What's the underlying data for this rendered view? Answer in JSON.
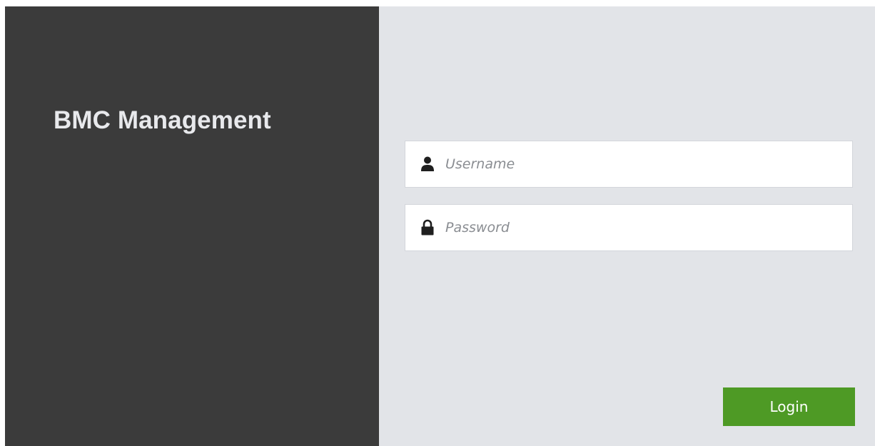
{
  "branding": {
    "title": "BMC Management"
  },
  "login_form": {
    "username": {
      "placeholder": "Username",
      "value": "",
      "icon": "user-icon"
    },
    "password": {
      "placeholder": "Password",
      "value": "",
      "icon": "lock-icon"
    },
    "submit_label": "Login"
  },
  "colors": {
    "left_panel_bg": "#3b3b3b",
    "right_panel_bg": "#e2e4e8",
    "brand_text": "#e8e9ec",
    "button_bg": "#4e9a25",
    "button_text": "#ffffff",
    "placeholder_text": "#8a8d92"
  }
}
